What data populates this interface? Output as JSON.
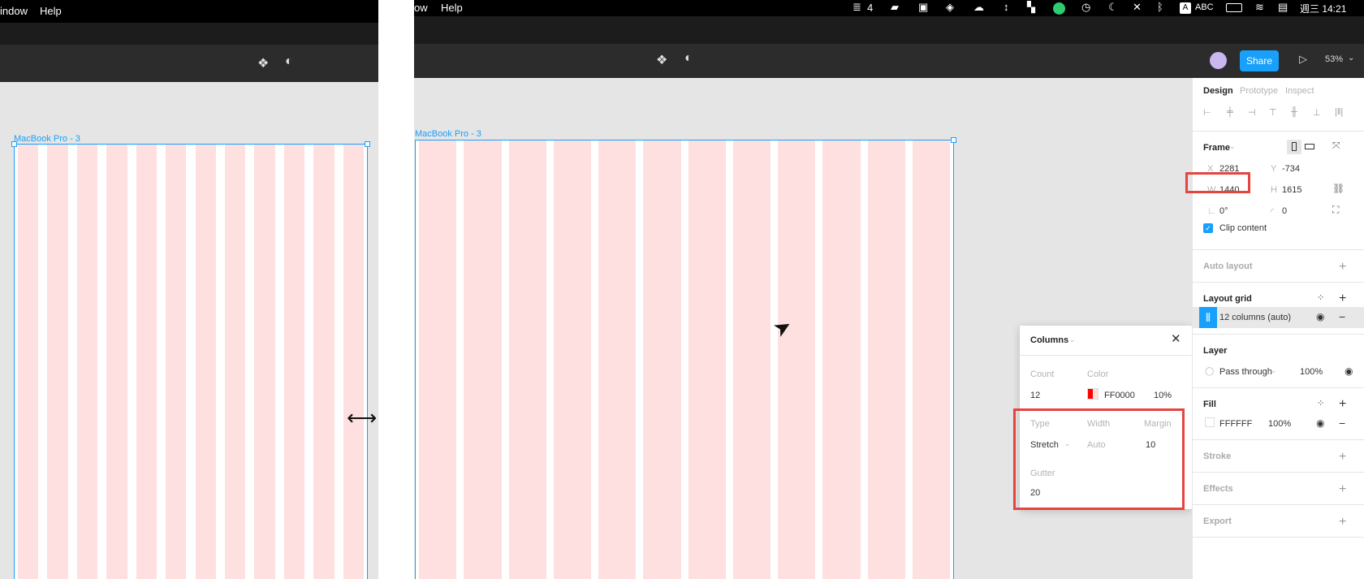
{
  "left": {
    "menu": [
      "indow",
      "Help"
    ],
    "frame_label": "MacBook Pro - 3",
    "toolbar_icons": [
      "component-icon",
      "contrast-icon"
    ],
    "cursor": "resize-horizontal-cursor"
  },
  "right": {
    "menu": [
      "ow",
      "Help"
    ],
    "status": {
      "badge": "4",
      "abc": "ABC",
      "clock": "週三 14:21"
    },
    "toolbar": {
      "share": "Share",
      "zoom": "53%"
    },
    "frame_label": "MacBook Pro - 3",
    "panel": {
      "tabs": [
        "Design",
        "Prototype",
        "Inspect"
      ],
      "frame_title": "Frame",
      "x_label": "X",
      "x_value": "2281",
      "y_label": "Y",
      "y_value": "-734",
      "w_label": "W",
      "w_value": "1440",
      "h_label": "H",
      "h_value": "1615",
      "rotation": "0°",
      "radius": "0",
      "clip_content": "Clip content",
      "auto_layout": "Auto layout",
      "layout_grid": "Layout grid",
      "grid_item": "12 columns (auto)",
      "layer": "Layer",
      "blend": "Pass through",
      "layer_opacity": "100%",
      "fill": "Fill",
      "fill_color": "FFFFFF",
      "fill_opacity": "100%",
      "stroke": "Stroke",
      "effects": "Effects",
      "export": "Export"
    },
    "columns_popup": {
      "title": "Columns",
      "count_label": "Count",
      "count": "12",
      "color_label": "Color",
      "color": "FF0000",
      "opacity": "10%",
      "type_label": "Type",
      "type": "Stretch",
      "width_label": "Width",
      "width": "Auto",
      "margin_label": "Margin",
      "margin": "10",
      "gutter_label": "Gutter",
      "gutter": "20"
    }
  },
  "colors": {
    "accent": "#18a0fb",
    "highlight": "#e5443f",
    "grid_fill": "#fde0df"
  }
}
